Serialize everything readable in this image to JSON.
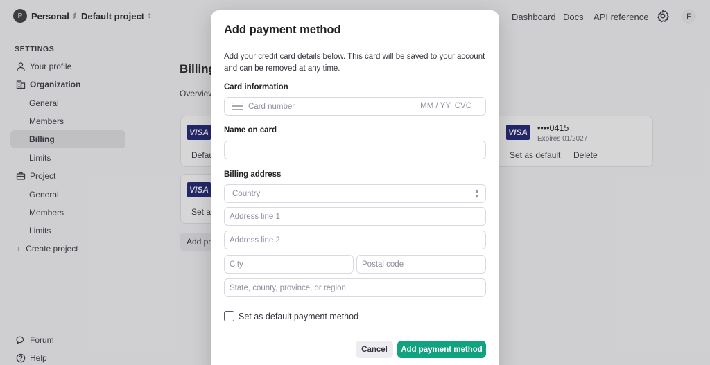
{
  "header": {
    "org_initial": "P",
    "org_name": "Personal",
    "separator": "/",
    "project_name": "Default project",
    "caret": "⌃⌄",
    "nav": [
      {
        "label": "Dashboard"
      },
      {
        "label": "Docs"
      },
      {
        "label": "API reference"
      }
    ],
    "settings_icon": "gear-icon",
    "user_initial": "F"
  },
  "sidebar": {
    "heading": "SETTINGS",
    "items": [
      {
        "label": "Your profile",
        "icon": "user-icon"
      },
      {
        "label": "Organization",
        "icon": "building-icon"
      },
      {
        "label": "General"
      },
      {
        "label": "Members"
      },
      {
        "label": "Billing"
      },
      {
        "label": "Limits"
      },
      {
        "label": "Project",
        "icon": "briefcase-icon"
      },
      {
        "label": "General"
      },
      {
        "label": "Members"
      },
      {
        "label": "Limits"
      },
      {
        "label": "Create project",
        "icon": "plus-icon"
      }
    ],
    "footer": [
      {
        "label": "Forum",
        "icon": "chat-icon"
      },
      {
        "label": "Help",
        "icon": "help-icon"
      }
    ]
  },
  "main": {
    "title": "Billing",
    "tab_overview": "Overview",
    "cards": [
      {
        "brand": "VISA",
        "action": "Default"
      },
      {
        "brand": "VISA",
        "action": "Set as"
      }
    ],
    "right_card": {
      "brand": "VISA",
      "number": "••••0415",
      "expires": "Expires 01/2027",
      "set_default": "Set as default",
      "delete": "Delete"
    },
    "add_button": "Add pa"
  },
  "modal": {
    "title": "Add payment method",
    "description": "Add your credit card details below. This card will be saved to your account and can be removed at any time.",
    "card_info_label": "Card information",
    "card_number_placeholder": "Card number",
    "card_expiry_placeholder": "MM / YY",
    "card_cvc_placeholder": "CVC",
    "name_label": "Name on card",
    "name_value": "",
    "billing_label": "Billing address",
    "country_placeholder": "Country",
    "address1_placeholder": "Address line 1",
    "address2_placeholder": "Address line 2",
    "city_placeholder": "City",
    "postal_placeholder": "Postal code",
    "region_placeholder": "State, county, province, or region",
    "default_checkbox_label": "Set as default payment method",
    "default_checked": false,
    "cancel_label": "Cancel",
    "submit_label": "Add payment method",
    "accent_color": "#10a37f"
  }
}
